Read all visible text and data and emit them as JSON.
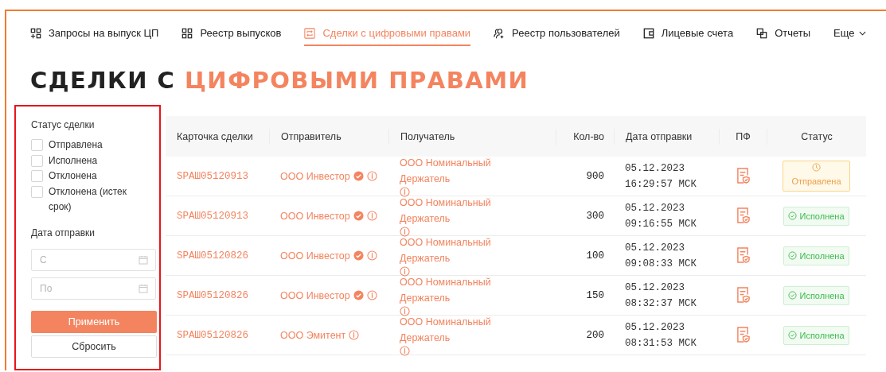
{
  "nav": [
    {
      "label": "Запросы на выпуск ЦП",
      "selected": false
    },
    {
      "label": "Реестр выпусков",
      "selected": false
    },
    {
      "label": "Сделки с цифровыми правами",
      "selected": true
    },
    {
      "label": "Реестр пользователей",
      "selected": false
    },
    {
      "label": "Лицевые счета",
      "selected": false
    },
    {
      "label": "Отчеты",
      "selected": false
    },
    {
      "label": "Еще",
      "selected": false
    }
  ],
  "title": {
    "dark": "СДЕЛКИ С",
    "accent": "ЦИФРОВЫМИ ПРАВАМИ"
  },
  "filters": {
    "status_label": "Статус сделки",
    "statuses": [
      {
        "label": "Отправлена",
        "checked": false
      },
      {
        "label": "Исполнена",
        "checked": false
      },
      {
        "label": "Отклонена",
        "checked": false
      },
      {
        "label": "Отклонена (истек срок)",
        "checked": false
      }
    ],
    "date_label": "Дата отправки",
    "date_from": {
      "placeholder": "С"
    },
    "date_to": {
      "placeholder": "По"
    },
    "apply": "Применить",
    "reset": "Сбросить"
  },
  "table": {
    "columns": [
      "Карточка сделки",
      "Отправитель",
      "Получатель",
      "Кол-во",
      "Дата отправки",
      "ПФ",
      "Статус"
    ],
    "rows": [
      {
        "card": "SPAШ05120913",
        "sender": "ООО Инвестор",
        "sender_verified": true,
        "recipient": "ООО Номинальный Держатель",
        "qty": "900",
        "date": "05.12.2023",
        "time": "16:29:57 МСК",
        "status": "Отправлена",
        "kind": "sent"
      },
      {
        "card": "SPAШ05120913",
        "sender": "ООО Инвестор",
        "sender_verified": true,
        "recipient": "ООО Номинальный Держатель",
        "qty": "300",
        "date": "05.12.2023",
        "time": "09:16:55 МСК",
        "status": "Исполнена",
        "kind": "done"
      },
      {
        "card": "SPAШ05120826",
        "sender": "ООО Инвестор",
        "sender_verified": true,
        "recipient": "ООО Номинальный Держатель",
        "qty": "100",
        "date": "05.12.2023",
        "time": "09:08:33 МСК",
        "status": "Исполнена",
        "kind": "done"
      },
      {
        "card": "SPAШ05120826",
        "sender": "ООО Инвестор",
        "sender_verified": true,
        "recipient": "ООО Номинальный Держатель",
        "qty": "150",
        "date": "05.12.2023",
        "time": "08:32:37 МСК",
        "status": "Исполнена",
        "kind": "done"
      },
      {
        "card": "SPAШ05120826",
        "sender": "ООО Эмитент",
        "sender_verified": false,
        "recipient": "ООО Номинальный Держатель",
        "qty": "200",
        "date": "05.12.2023",
        "time": "08:31:53 МСК",
        "status": "Исполнена",
        "kind": "done"
      }
    ]
  }
}
